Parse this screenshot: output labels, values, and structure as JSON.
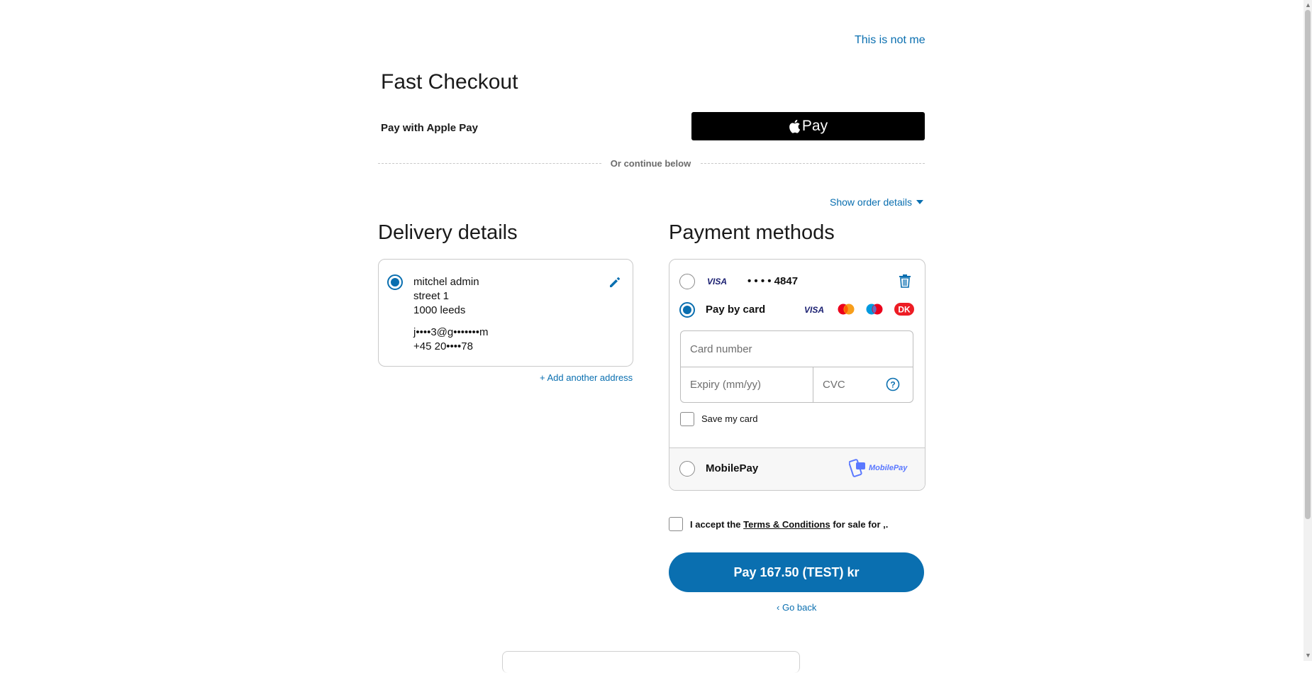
{
  "header": {
    "not_me_link": "This is not me",
    "title": "Fast Checkout"
  },
  "apple_pay": {
    "label": "Pay with Apple Pay",
    "button_text": "Pay"
  },
  "divider": {
    "text": "Or continue below"
  },
  "order_details": {
    "toggle_label": "Show order details"
  },
  "delivery": {
    "heading": "Delivery details",
    "address": {
      "name": "mitchel admin",
      "street": "street 1",
      "city": "1000 leeds",
      "email": "j••••3@g•••••••m",
      "phone": "+45 20••••78"
    },
    "add_address_label": "+ Add another address"
  },
  "payment": {
    "heading": "Payment methods",
    "saved_card": {
      "brand": "VISA",
      "masked_number": "• • • • 4847"
    },
    "pay_by_card": {
      "label": "Pay by card",
      "brands": [
        "VISA",
        "mastercard-icon",
        "maestro-icon",
        "dankort-icon"
      ],
      "card_number_placeholder": "Card number",
      "expiry_placeholder": "Expiry (mm/yy)",
      "cvc_placeholder": "CVC",
      "save_card_label": "Save my card"
    },
    "mobilepay": {
      "label": "MobilePay",
      "logo_text": "MobilePay"
    }
  },
  "terms": {
    "prefix": "I accept the",
    "link": "Terms & Conditions",
    "suffix": "for sale for ,."
  },
  "pay_button": "Pay 167.50 (TEST) kr",
  "go_back": "Go back",
  "colors": {
    "accent": "#0a6fb0",
    "apple_pay_bg": "#000000"
  }
}
